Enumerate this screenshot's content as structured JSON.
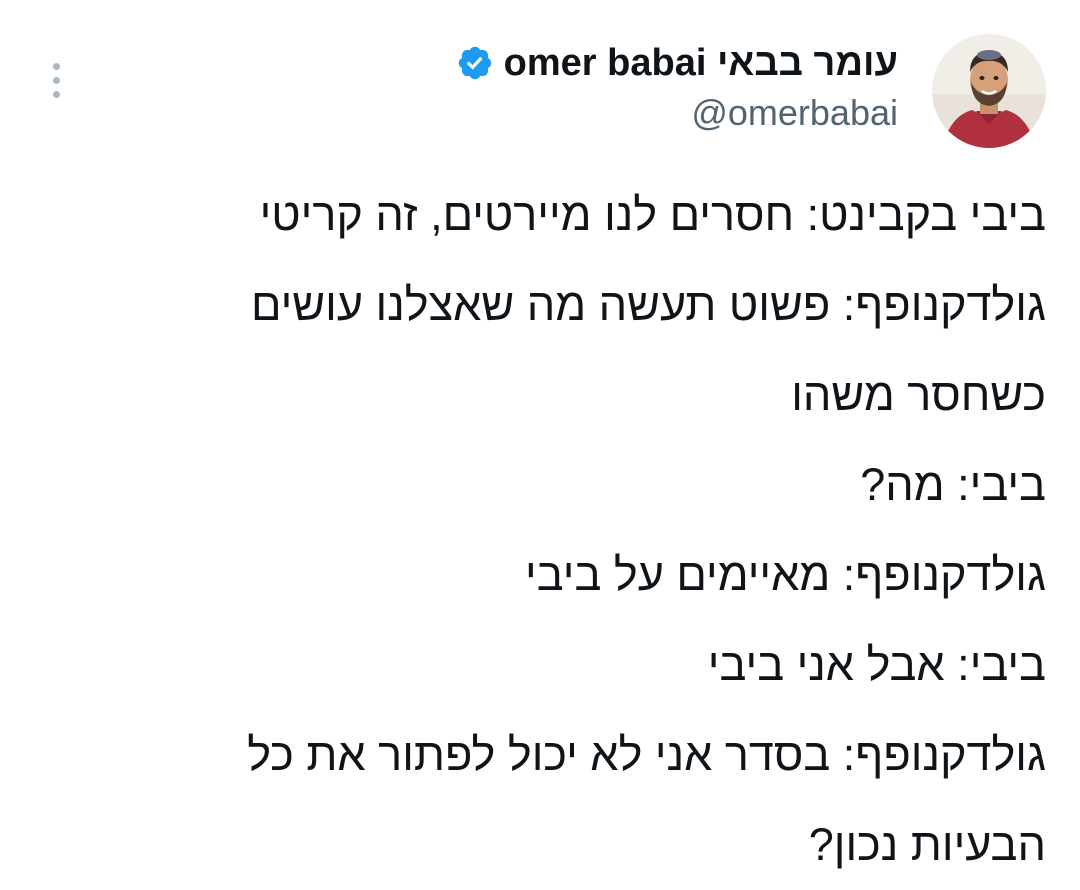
{
  "tweet": {
    "author": {
      "display_name": "עומר בבאי omer babai",
      "handle": "@omerbabai",
      "verified": true,
      "avatar_icon": "profile-photo"
    },
    "more_icon": "more-vertical-icon",
    "text_lines": [
      "ביבי בקבינט: חסרים לנו מיירטים, זה קריטי",
      "גולדקנופף: פשוט תעשה מה שאצלנו עושים",
      "כשחסר משהו",
      "ביבי: מה?",
      "גולדקנופף: מאיימים על ביבי",
      "ביבי: אבל אני ביבי",
      "גולדקנופף: בסדר אני לא יכול לפתור את כל",
      "הבעיות נכון?"
    ]
  },
  "colors": {
    "text": "#0f1419",
    "secondary": "#536471",
    "verified_badge": "#1d9bf0",
    "background": "#ffffff"
  }
}
